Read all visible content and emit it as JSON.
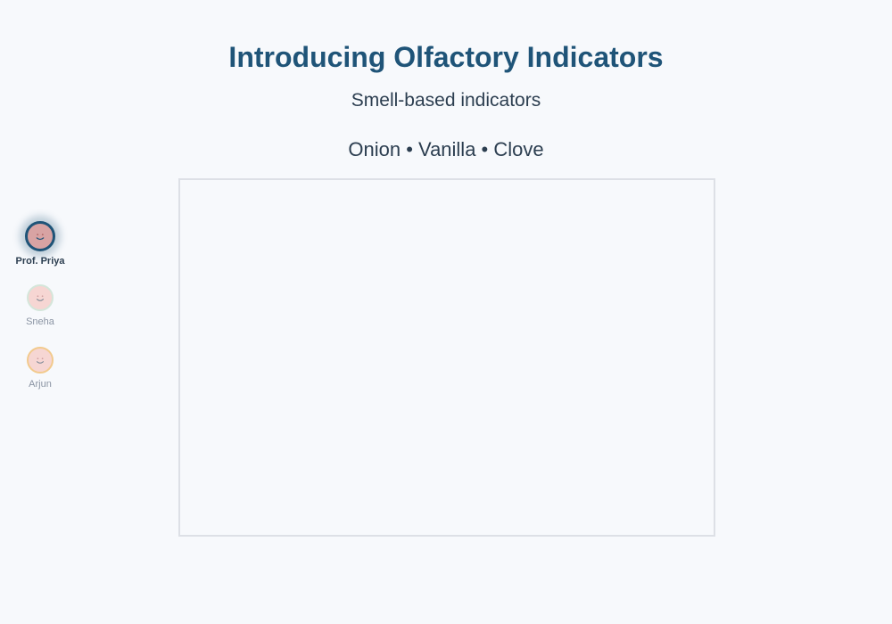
{
  "slide": {
    "title": "Introducing Olfactory Indicators",
    "subtitle": "Smell-based indicators",
    "items_line": "Onion • Vanilla • Clove"
  },
  "participants": [
    {
      "name": "Prof. Priya",
      "active": true,
      "icon": "smiley-face-icon",
      "ring_color": "#1f5478"
    },
    {
      "name": "Sneha",
      "active": false,
      "icon": "smiley-face-icon",
      "ring_color": "#cfe3d5"
    },
    {
      "name": "Arjun",
      "active": false,
      "icon": "smiley-face-icon",
      "ring_color": "#f2c27a"
    }
  ],
  "colors": {
    "background": "#f7f9fc",
    "title": "#1f5478",
    "text": "#2c3e50",
    "stage_border": "#dde0e6",
    "avatar_fill": "#f6d0cc"
  }
}
